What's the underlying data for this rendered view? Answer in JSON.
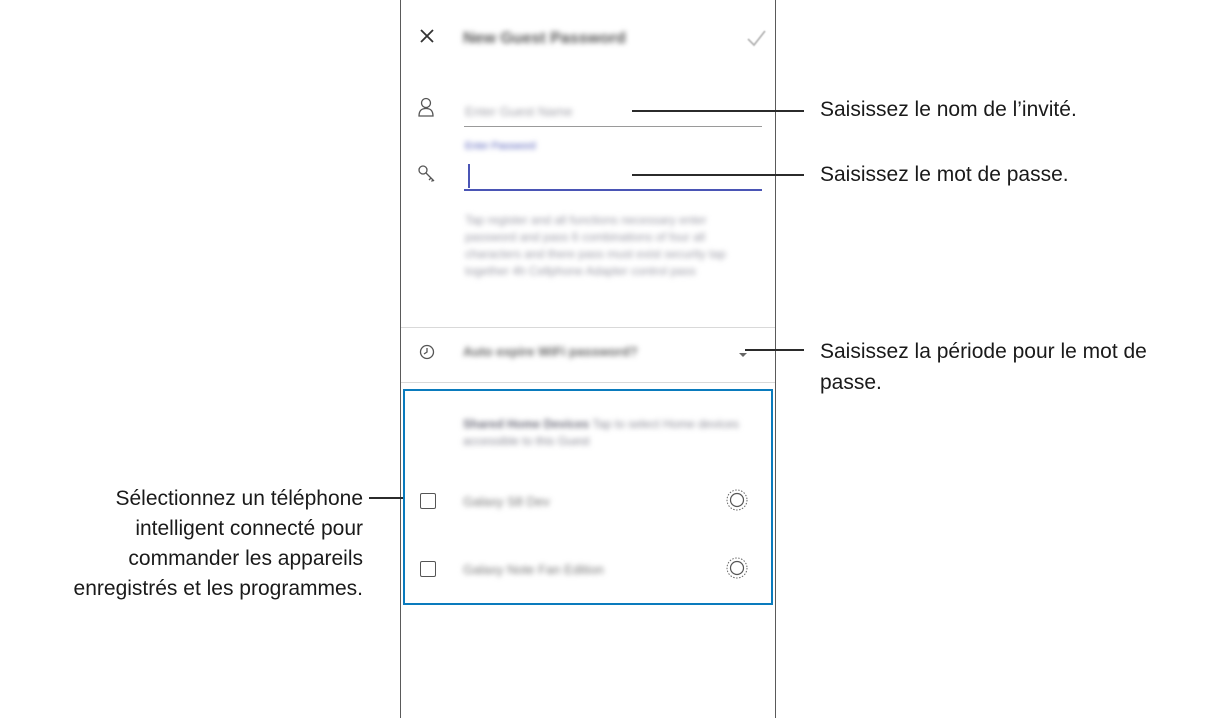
{
  "dialog": {
    "title": "New Guest Password",
    "guest_name_placeholder": "Enter Guest Name",
    "password_label": "Enter Password",
    "info_text": "Tap register and all functions necessary enter password and pass 6 combinations of four all characters and there pass must exist security tap together 4h Cellphone Adapter control pass",
    "expiry_value": "Auto expire WiFi password?",
    "devices_header": "Shared Home Devices",
    "devices_subtext": "Tap to select Home devices accessible to this Guest",
    "devices": [
      {
        "name": "Galaxy S8 Dev"
      },
      {
        "name": "Galaxy Note Fan Edition"
      }
    ]
  },
  "annotations": {
    "guest_name": "Saisissez le nom de l’invité.",
    "password": "Saisissez le mot de passe.",
    "period_line1": "Saisissez la période pour le mot de",
    "period_line2": "passe.",
    "select_line1": "Sélectionnez un téléphone",
    "select_line2": "intelligent connecté pour",
    "select_line3": "commander les appareils",
    "select_line4": "enregistrés et les programmes."
  },
  "colors": {
    "accent": "#4a55b5",
    "highlight_box": "#0a7bbd"
  }
}
